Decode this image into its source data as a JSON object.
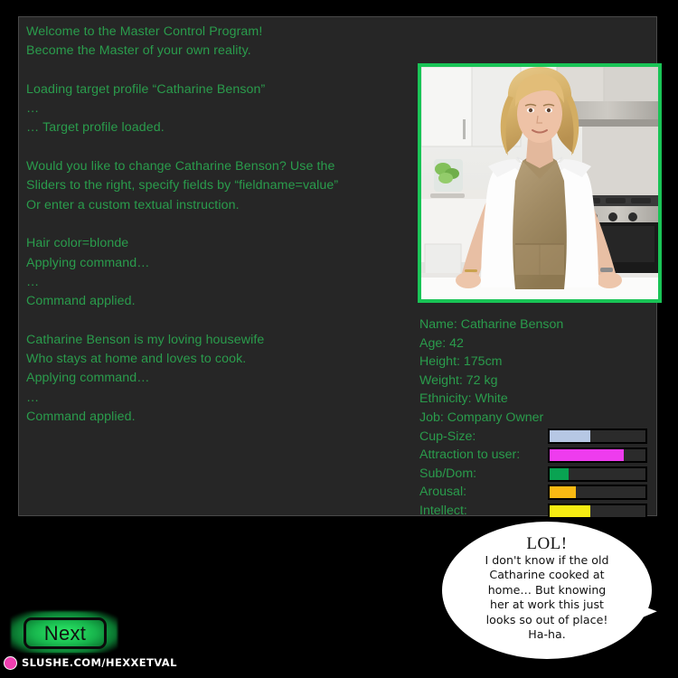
{
  "window": {
    "background_color": "#000000",
    "panel_color": "#262626",
    "panel_border_color": "#4a4a4a",
    "terminal_text_color": "#2a9c4c",
    "frame_accent_color": "#19c456"
  },
  "terminal": {
    "lines": [
      "Welcome to the Master Control Program!",
      "Become the Master of your own reality.",
      "",
      "Loading target profile “Catharine Benson”",
      "…",
      "… Target profile loaded.",
      "",
      "Would you like to change Catharine Benson? Use the",
      "Sliders to the right, specify fields by “fieldname=value”",
      "Or enter a custom textual instruction.",
      "",
      "Hair color=blonde",
      "Applying command…",
      "…",
      "Command applied.",
      "",
      "Catharine Benson is my loving housewife",
      "Who stays at home and loves to cook.",
      "Applying command…",
      "…",
      "Command applied."
    ]
  },
  "portrait": {
    "alt": "target-profile-photo",
    "description": "Blonde woman in white collared shirt and tan apron standing in a white kitchen"
  },
  "stats": {
    "text_fields": [
      {
        "label": "Name:",
        "value": "Catharine Benson"
      },
      {
        "label": "Age:",
        "value": "42"
      },
      {
        "label": "Height:",
        "value": "175cm"
      },
      {
        "label": "Weight:",
        "value": "72 kg"
      },
      {
        "label": "Ethnicity:",
        "value": "White"
      },
      {
        "label": "Job:",
        "value": "Company Owner"
      }
    ],
    "sliders": [
      {
        "label": "Cup-Size:",
        "percent": 42,
        "color": "#b6c7e4"
      },
      {
        "label": "Attraction to user:",
        "percent": 77,
        "color": "#ee3cee"
      },
      {
        "label": "Sub/Dom:",
        "percent": 20,
        "color": "#09a352"
      },
      {
        "label": "Arousal:",
        "percent": 27,
        "color": "#f9ba13"
      },
      {
        "label": "Intellect:",
        "percent": 42,
        "color": "#f6ec12"
      }
    ]
  },
  "speech_bubble": {
    "exclamation": "LOL!",
    "lines": [
      "I don't know if the old",
      "Catharine cooked at",
      "home… But knowing",
      "her at work this just",
      "looks so out of place!",
      "Ha-ha."
    ]
  },
  "next_button": {
    "label": "Next",
    "glow_color": "#2ff06a"
  },
  "watermark": {
    "text": "SLUSHE.COM/HEXXETVAL",
    "icon": "slushe-logo-icon",
    "icon_color": "#ef3fb0"
  }
}
